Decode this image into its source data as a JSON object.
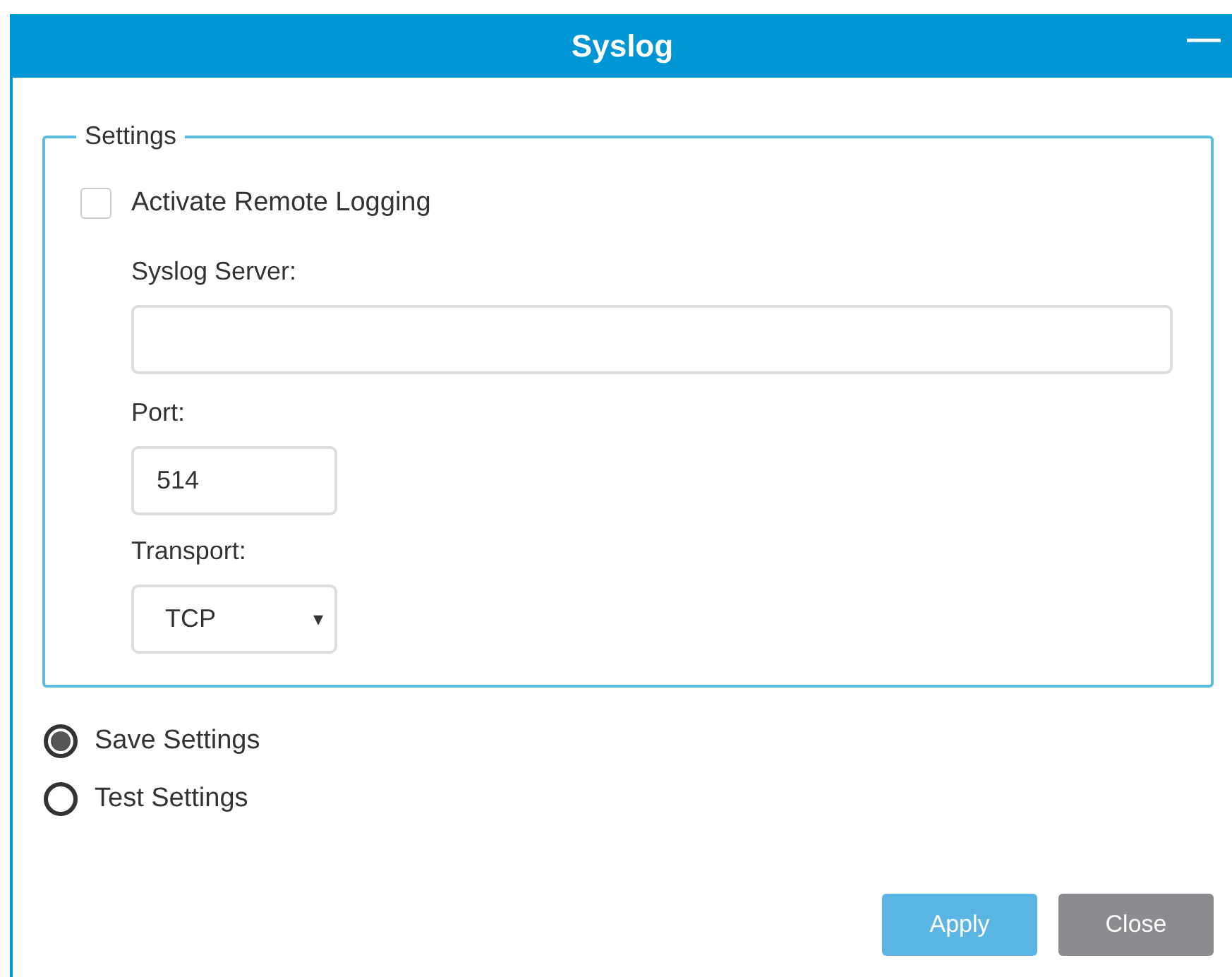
{
  "window": {
    "title": "Syslog",
    "minimize_symbol": "—"
  },
  "settings": {
    "legend": "Settings",
    "activate": {
      "label": "Activate Remote Logging",
      "checked": false
    },
    "server": {
      "label": "Syslog Server:"
    },
    "port": {
      "label": "Port:",
      "value": "514"
    },
    "transport": {
      "label": "Transport:",
      "value": "TCP",
      "caret": "▾"
    }
  },
  "modes": [
    {
      "label": "Save Settings",
      "selected": true
    },
    {
      "label": "Test Settings",
      "selected": false
    }
  ],
  "buttons": [
    {
      "label": "Apply",
      "kind": "primary"
    },
    {
      "label": "Close",
      "kind": "secondary"
    }
  ]
}
